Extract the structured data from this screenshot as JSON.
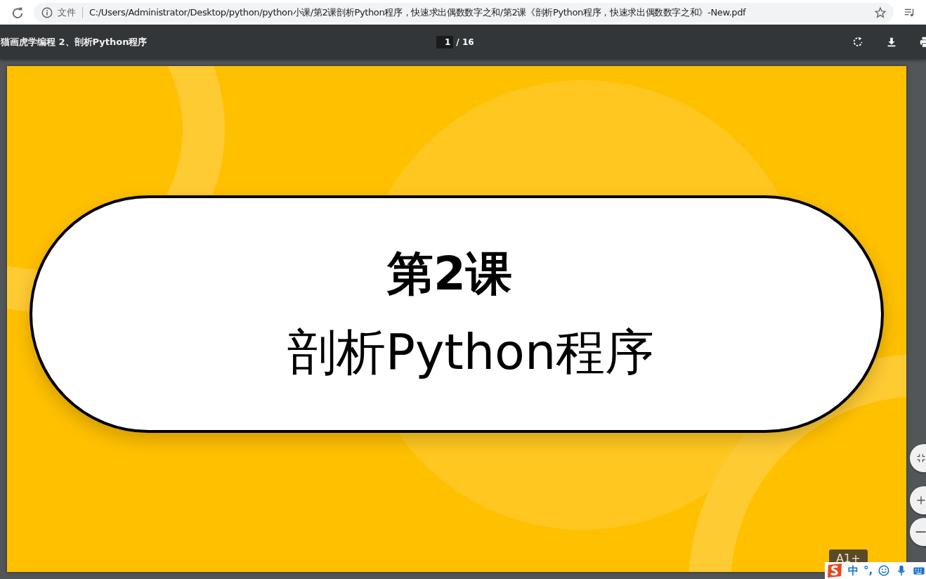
{
  "browser": {
    "url_label": "文件",
    "url": "C:/Users/Administrator/Desktop/python/python小课/第2课剖析Python程序，快速求出偶数数字之和/第2课《剖析Python程序，快速求出偶数数字之和》-New.pdf"
  },
  "pdf_toolbar": {
    "title": "猫画虎学编程 2、剖析Python程序",
    "page_current": "1",
    "page_total": "/ 16"
  },
  "slide": {
    "lesson": "第2课",
    "title": "剖析Python程序"
  },
  "zoom_tooltip": "A1+",
  "ime_bar": {
    "mode": "中",
    "punctuation": "°,"
  }
}
